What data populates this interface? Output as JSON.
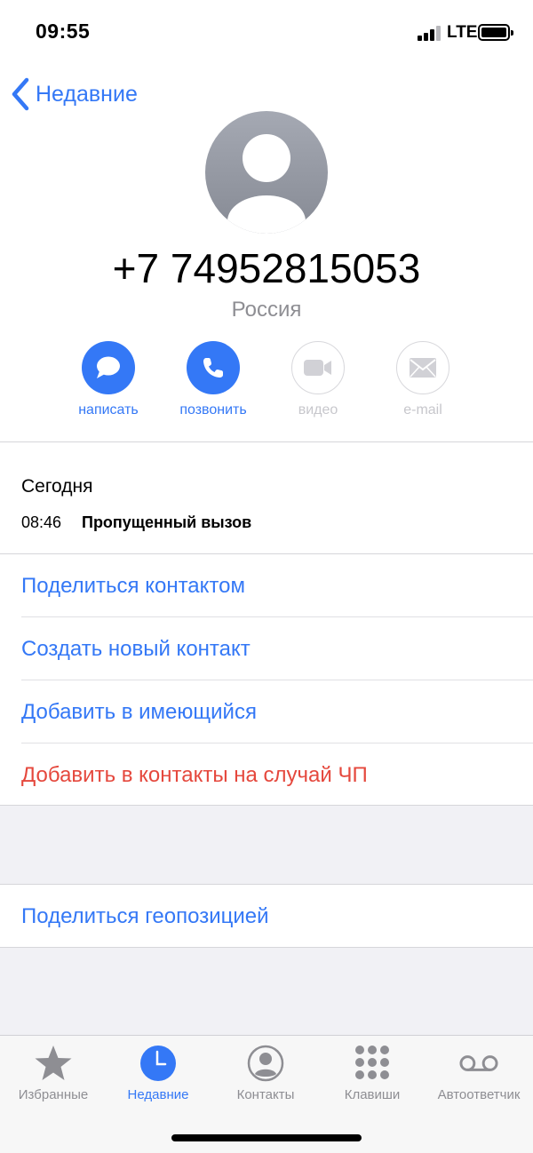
{
  "status": {
    "time": "09:55",
    "network": "LTE"
  },
  "nav": {
    "back_label": "Недавние"
  },
  "contact": {
    "number": "+7 74952815053",
    "country": "Россия"
  },
  "actions": [
    {
      "label": "написать",
      "icon": "message-icon",
      "enabled": true
    },
    {
      "label": "позвонить",
      "icon": "phone-icon",
      "enabled": true
    },
    {
      "label": "видео",
      "icon": "video-icon",
      "enabled": false
    },
    {
      "label": "e-mail",
      "icon": "mail-icon",
      "enabled": false
    }
  ],
  "history": {
    "day": "Сегодня",
    "time": "08:46",
    "type": "Пропущенный вызов"
  },
  "options": [
    {
      "label": "Поделиться контактом"
    },
    {
      "label": "Создать новый контакт"
    },
    {
      "label": "Добавить в имеющийся"
    },
    {
      "label": "Добавить в контакты на случай ЧП",
      "color": "#e5483d"
    }
  ],
  "location_option": {
    "label": "Поделиться геопозицией"
  },
  "tabs": [
    {
      "label": "Избранные",
      "icon": "star-icon",
      "active": false
    },
    {
      "label": "Недавние",
      "icon": "clock-icon",
      "active": true
    },
    {
      "label": "Контакты",
      "icon": "contact-icon",
      "active": false
    },
    {
      "label": "Клавиши",
      "icon": "keypad-icon",
      "active": false
    },
    {
      "label": "Автоответчик",
      "icon": "voicemail-icon",
      "active": false
    }
  ],
  "colors": {
    "accent": "#3478f6",
    "destructive": "#e5483d",
    "inactive": "#8e8e93"
  }
}
